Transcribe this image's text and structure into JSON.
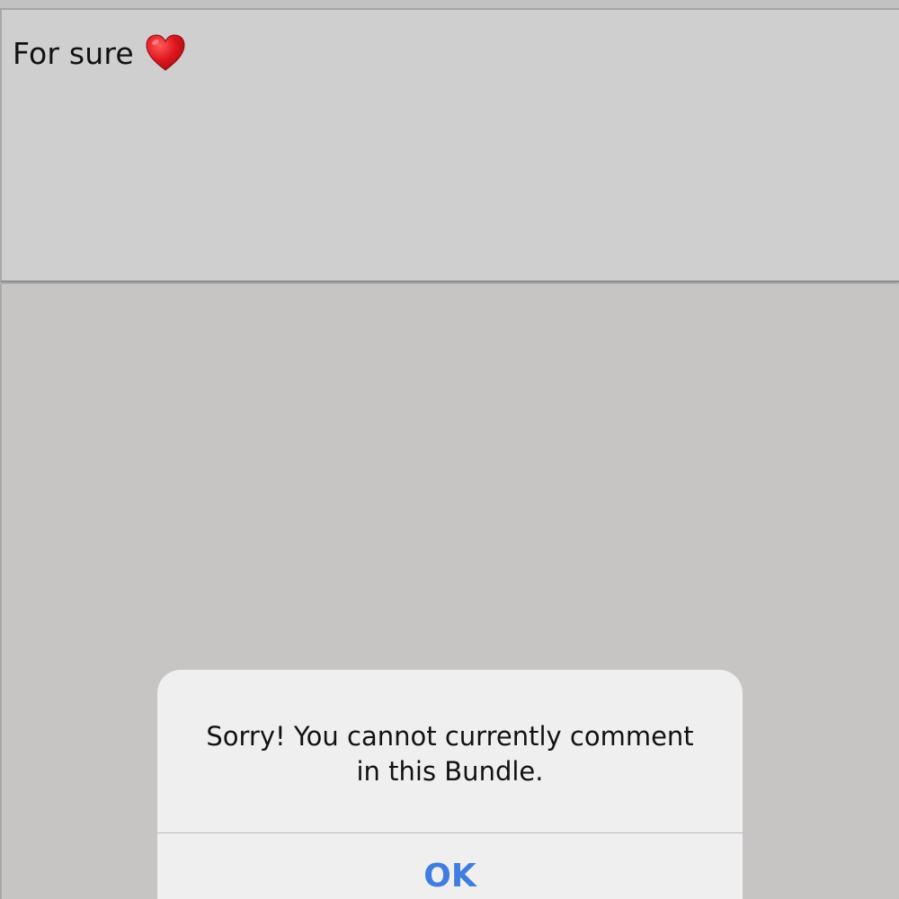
{
  "comment": {
    "text": "For sure",
    "emoji_icon": "red-heart-icon",
    "heart_color": "#d4171c"
  },
  "alert": {
    "message": "Sorry! You cannot currently comment in this Bundle.",
    "ok_label": "OK",
    "button_color": "#3f7ee0"
  }
}
